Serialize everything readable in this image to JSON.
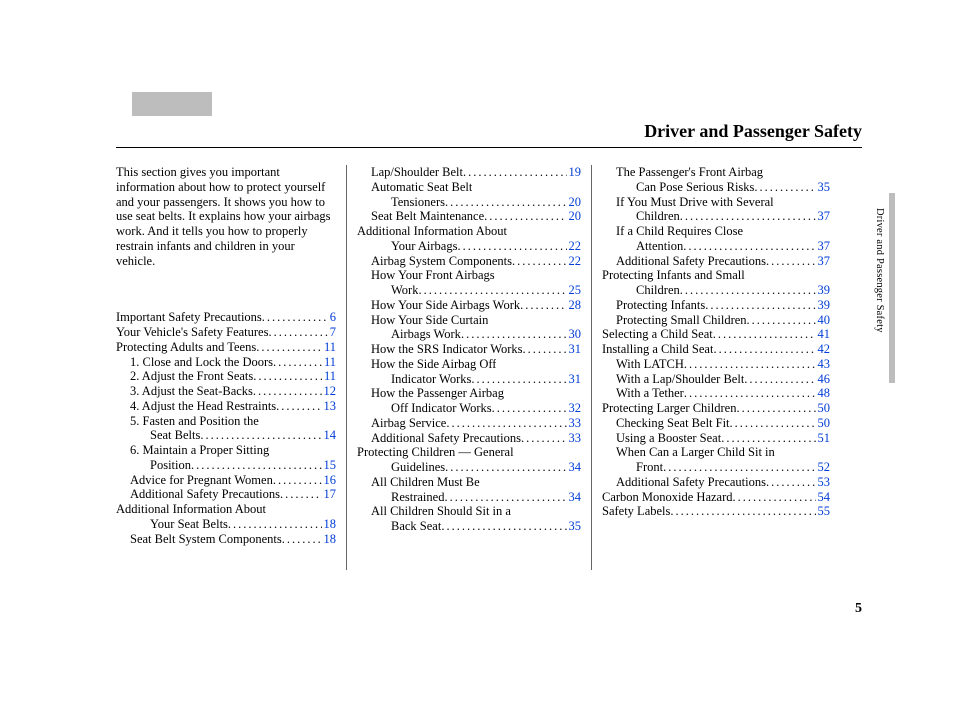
{
  "title": "Driver and Passenger Safety",
  "intro": "This section gives you important information about how to protect yourself and your passengers. It shows you how to use seat belts. It explains how your airbags work. And it tells you how to properly restrain infants and children in your vehicle.",
  "side_label": "Driver and Passenger Safety",
  "page_number": "5",
  "columns": [
    [
      {
        "label": "Important Safety Precautions",
        "page": "6",
        "indent": 0
      },
      {
        "label": "Your Vehicle's Safety Features",
        "page": "7",
        "indent": 0
      },
      {
        "label": "Protecting Adults and Teens",
        "page": "11",
        "indent": 0
      },
      {
        "label": "1. Close and Lock the Doors",
        "page": "11",
        "indent": 1
      },
      {
        "label": "2. Adjust the Front Seats",
        "page": "11",
        "indent": 1
      },
      {
        "label": "3. Adjust the Seat-Backs",
        "page": "12",
        "indent": 1
      },
      {
        "label": "4. Adjust the Head Restraints",
        "page": "13",
        "indent": 1
      },
      {
        "label": "5. Fasten and Position the",
        "indent": 1,
        "cont": true
      },
      {
        "label": "Seat Belts",
        "page": "14",
        "indent": 2
      },
      {
        "label": "6. Maintain a Proper Sitting",
        "indent": 1,
        "cont": true
      },
      {
        "label": "Position",
        "page": "15",
        "indent": 2
      },
      {
        "label": "Advice for Pregnant Women",
        "page": "16",
        "indent": 1
      },
      {
        "label": "Additional Safety Precautions",
        "page": "17",
        "indent": 1
      },
      {
        "label": "Additional Information About",
        "indent": 0,
        "cont": true
      },
      {
        "label": "Your Seat Belts",
        "page": "18",
        "indent": 2
      },
      {
        "label": "Seat Belt System Components",
        "page": "18",
        "indent": 1
      }
    ],
    [
      {
        "label": "Lap/Shoulder Belt",
        "page": "19",
        "indent": 1
      },
      {
        "label": "Automatic Seat Belt",
        "indent": 1,
        "cont": true
      },
      {
        "label": "Tensioners",
        "page": "20",
        "indent": 2
      },
      {
        "label": "Seat Belt Maintenance",
        "page": "20",
        "indent": 1
      },
      {
        "label": "Additional Information About",
        "indent": 0,
        "cont": true
      },
      {
        "label": "Your Airbags",
        "page": "22",
        "indent": 2
      },
      {
        "label": "Airbag System Components",
        "page": "22",
        "indent": 1
      },
      {
        "label": "How Your Front Airbags",
        "indent": 1,
        "cont": true
      },
      {
        "label": "Work",
        "page": "25",
        "indent": 2
      },
      {
        "label": "How Your Side Airbags Work",
        "page": "28",
        "indent": 1
      },
      {
        "label": "How Your Side Curtain",
        "indent": 1,
        "cont": true
      },
      {
        "label": "Airbags Work",
        "page": "30",
        "indent": 2
      },
      {
        "label": "How the SRS Indicator Works",
        "page": "31",
        "indent": 1
      },
      {
        "label": "How the Side Airbag Off",
        "indent": 1,
        "cont": true
      },
      {
        "label": "Indicator Works",
        "page": "31",
        "indent": 2
      },
      {
        "label": "How the Passenger Airbag",
        "indent": 1,
        "cont": true
      },
      {
        "label": "Off Indicator Works",
        "page": "32",
        "indent": 2
      },
      {
        "label": "Airbag Service",
        "page": "33",
        "indent": 1
      },
      {
        "label": "Additional Safety Precautions",
        "page": "33",
        "indent": 1
      },
      {
        "label": "Protecting Children — General",
        "indent": 0,
        "cont": true
      },
      {
        "label": "Guidelines",
        "page": "34",
        "indent": 2
      },
      {
        "label": "All Children Must Be",
        "indent": 1,
        "cont": true
      },
      {
        "label": "Restrained",
        "page": "34",
        "indent": 2
      },
      {
        "label": "All Children Should Sit in a",
        "indent": 1,
        "cont": true
      },
      {
        "label": "Back Seat",
        "page": "35",
        "indent": 2
      }
    ],
    [
      {
        "label": "The Passenger's Front Airbag",
        "indent": 1,
        "cont": true
      },
      {
        "label": "Can Pose Serious Risks",
        "page": "35",
        "indent": 2
      },
      {
        "label": "If You Must Drive with Several",
        "indent": 1,
        "cont": true
      },
      {
        "label": "Children",
        "page": "37",
        "indent": 2
      },
      {
        "label": "If a Child Requires Close",
        "indent": 1,
        "cont": true
      },
      {
        "label": "Attention",
        "page": "37",
        "indent": 2
      },
      {
        "label": "Additional Safety Precautions",
        "page": "37",
        "indent": 1
      },
      {
        "label": "Protecting Infants and Small",
        "indent": 0,
        "cont": true
      },
      {
        "label": "Children",
        "page": "39",
        "indent": 2
      },
      {
        "label": "Protecting Infants",
        "page": "39",
        "indent": 1
      },
      {
        "label": "Protecting Small Children",
        "page": "40",
        "indent": 1
      },
      {
        "label": "Selecting a Child Seat",
        "page": "41",
        "indent": 0
      },
      {
        "label": "Installing a Child Seat",
        "page": "42",
        "indent": 0
      },
      {
        "label": "With LATCH",
        "page": "43",
        "indent": 1
      },
      {
        "label": "With a Lap/Shoulder Belt",
        "page": "46",
        "indent": 1
      },
      {
        "label": "With a Tether",
        "page": "48",
        "indent": 1
      },
      {
        "label": "Protecting Larger Children",
        "page": "50",
        "indent": 0
      },
      {
        "label": "Checking Seat Belt Fit",
        "page": "50",
        "indent": 1
      },
      {
        "label": "Using a Booster Seat",
        "page": "51",
        "indent": 1
      },
      {
        "label": "When Can a Larger Child Sit in",
        "indent": 1,
        "cont": true
      },
      {
        "label": "Front",
        "page": "52",
        "indent": 2
      },
      {
        "label": "Additional Safety Precautions",
        "page": "53",
        "indent": 1
      },
      {
        "label": "Carbon Monoxide Hazard",
        "page": "54",
        "indent": 0
      },
      {
        "label": "Safety Labels",
        "page": "55",
        "indent": 0
      }
    ]
  ]
}
